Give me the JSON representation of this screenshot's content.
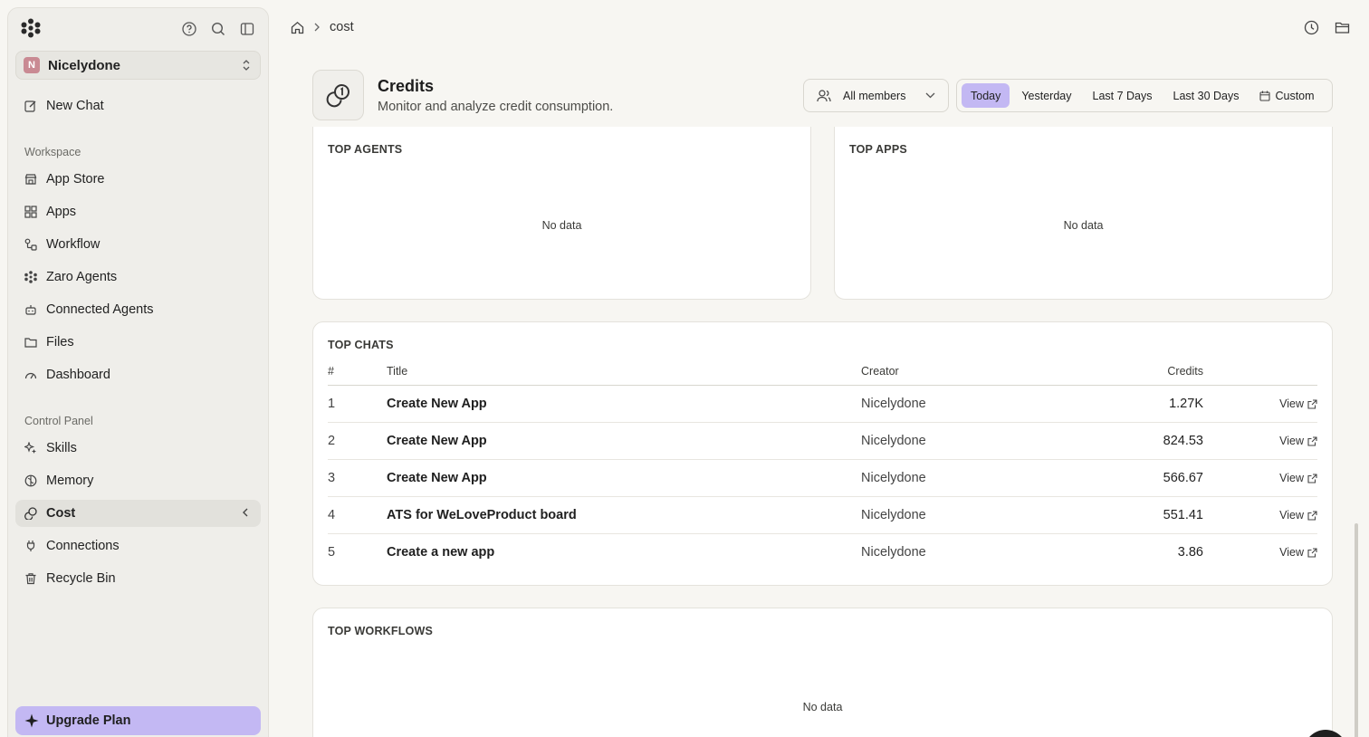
{
  "sidebar": {
    "workspace": {
      "avatar_letter": "N",
      "name": "Nicelydone"
    },
    "new_chat": "New Chat",
    "workspace_label": "Workspace",
    "workspace_items": [
      {
        "label": "App Store",
        "icon": "store-icon"
      },
      {
        "label": "Apps",
        "icon": "grid-icon"
      },
      {
        "label": "Workflow",
        "icon": "workflow-icon"
      },
      {
        "label": "Zaro Agents",
        "icon": "agents-icon"
      },
      {
        "label": "Connected Agents",
        "icon": "robot-icon"
      },
      {
        "label": "Files",
        "icon": "folder-icon"
      },
      {
        "label": "Dashboard",
        "icon": "gauge-icon"
      }
    ],
    "control_label": "Control Panel",
    "control_items": [
      {
        "label": "Skills",
        "icon": "sparkle-icon"
      },
      {
        "label": "Memory",
        "icon": "brain-icon"
      },
      {
        "label": "Cost",
        "icon": "coins-icon",
        "active": true
      },
      {
        "label": "Connections",
        "icon": "plug-icon"
      },
      {
        "label": "Recycle Bin",
        "icon": "trash-icon"
      }
    ],
    "upgrade": "Upgrade Plan"
  },
  "breadcrumb": {
    "current": "cost"
  },
  "header": {
    "title": "Credits",
    "subtitle": "Monitor and analyze credit consumption.",
    "member_filter": "All members",
    "ranges": [
      "Today",
      "Yesterday",
      "Last 7 Days",
      "Last 30 Days",
      "Custom"
    ],
    "active_range": "Today"
  },
  "top_agents": {
    "title": "TOP AGENTS",
    "empty": "No data"
  },
  "top_apps": {
    "title": "TOP APPS",
    "empty": "No data"
  },
  "top_chats": {
    "title": "TOP CHATS",
    "columns": {
      "num": "#",
      "title": "Title",
      "creator": "Creator",
      "credits": "Credits"
    },
    "rows": [
      {
        "num": "1",
        "title": "Create New App",
        "creator": "Nicelydone",
        "credits": "1.27K",
        "action": "View"
      },
      {
        "num": "2",
        "title": "Create New App",
        "creator": "Nicelydone",
        "credits": "824.53",
        "action": "View"
      },
      {
        "num": "3",
        "title": "Create New App",
        "creator": "Nicelydone",
        "credits": "566.67",
        "action": "View"
      },
      {
        "num": "4",
        "title": "ATS for WeLoveProduct board",
        "creator": "Nicelydone",
        "credits": "551.41",
        "action": "View"
      },
      {
        "num": "5",
        "title": "Create a new app",
        "creator": "Nicelydone",
        "credits": "3.86",
        "action": "View"
      }
    ]
  },
  "top_workflows": {
    "title": "TOP WORKFLOWS",
    "empty": "No data"
  },
  "colors": {
    "accent": "#c3b8f3",
    "background": "#f7f6f2",
    "sidebar": "#efeeea"
  }
}
